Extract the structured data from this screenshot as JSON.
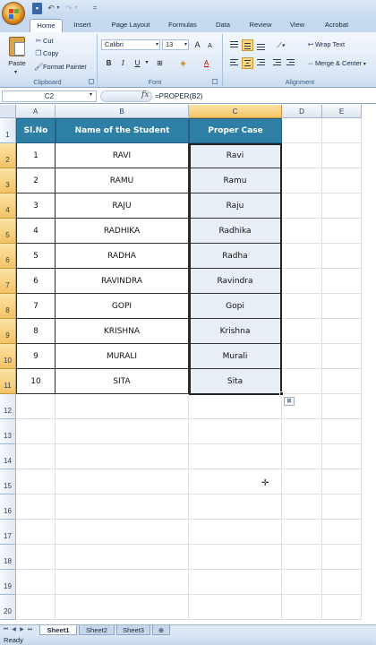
{
  "quick_access": {
    "customize": "="
  },
  "tabs": [
    {
      "label": "Home",
      "active": true
    },
    {
      "label": "Insert"
    },
    {
      "label": "Page Layout"
    },
    {
      "label": "Formulas"
    },
    {
      "label": "Data"
    },
    {
      "label": "Review"
    },
    {
      "label": "View"
    },
    {
      "label": "Acrobat"
    }
  ],
  "ribbon": {
    "clipboard": {
      "paste": "Paste",
      "cut": "Cut",
      "copy": "Copy",
      "format_painter": "Format Painter",
      "label": "Clipboard"
    },
    "font": {
      "name": "Calibri",
      "size": "13",
      "bold": "B",
      "italic": "I",
      "underline": "U",
      "grow": "A",
      "shrink": "A",
      "font_color": "A",
      "label": "Font"
    },
    "alignment": {
      "wrap_text": "Wrap Text",
      "merge_center": "Merge & Center",
      "label": "Alignment"
    }
  },
  "formula_bar": {
    "name_box": "C2",
    "fx": "fx",
    "formula": "=PROPER(B2)"
  },
  "columns": [
    "A",
    "B",
    "C",
    "D",
    "E"
  ],
  "rows": [
    "1",
    "2",
    "3",
    "4",
    "5",
    "6",
    "7",
    "8",
    "9",
    "10",
    "11",
    "12",
    "13",
    "14",
    "15",
    "16",
    "17",
    "18",
    "19",
    "20"
  ],
  "table": {
    "headers": [
      "Sl.No",
      "Name of the Student",
      "Proper Case"
    ],
    "rows": [
      [
        "1",
        "RAVI",
        "Ravi"
      ],
      [
        "2",
        "RAMU",
        "Ramu"
      ],
      [
        "3",
        "RAJU",
        "Raju"
      ],
      [
        "4",
        "RADHIKA",
        "Radhika"
      ],
      [
        "5",
        "RADHA",
        "Radha"
      ],
      [
        "6",
        "RAVINDRA",
        "Ravindra"
      ],
      [
        "7",
        "GOPI",
        "Gopi"
      ],
      [
        "8",
        "KRISHNA",
        "Krishna"
      ],
      [
        "9",
        "MURALI",
        "Murali"
      ],
      [
        "10",
        "SITA",
        "Sita"
      ]
    ]
  },
  "sheets": [
    {
      "label": "Sheet1",
      "active": true
    },
    {
      "label": "Sheet2"
    },
    {
      "label": "Sheet3"
    }
  ],
  "status": "Ready",
  "colors": {
    "header_fill": "#2e7fa5",
    "selection_fill": "#e8eef6",
    "ribbon": "#dbe7f5"
  }
}
